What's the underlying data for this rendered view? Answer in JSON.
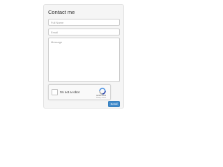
{
  "form": {
    "title": "Contact me",
    "full_name": {
      "value": "",
      "placeholder": "Full Name"
    },
    "email": {
      "value": "",
      "placeholder": "Email"
    },
    "message": {
      "value": "",
      "placeholder": "Message"
    },
    "send_label": "Send"
  },
  "recaptcha": {
    "checkbox_label": "I'm not a robot",
    "brand": "reCAPTCHA",
    "links": "Privacy - Terms",
    "checked": false,
    "icon": "recaptcha-logo-icon"
  },
  "colors": {
    "panel_background": "#f5f5f5",
    "panel_border": "#e3e3e3",
    "button_primary": "#428bca",
    "field_border": "#cccccc"
  }
}
